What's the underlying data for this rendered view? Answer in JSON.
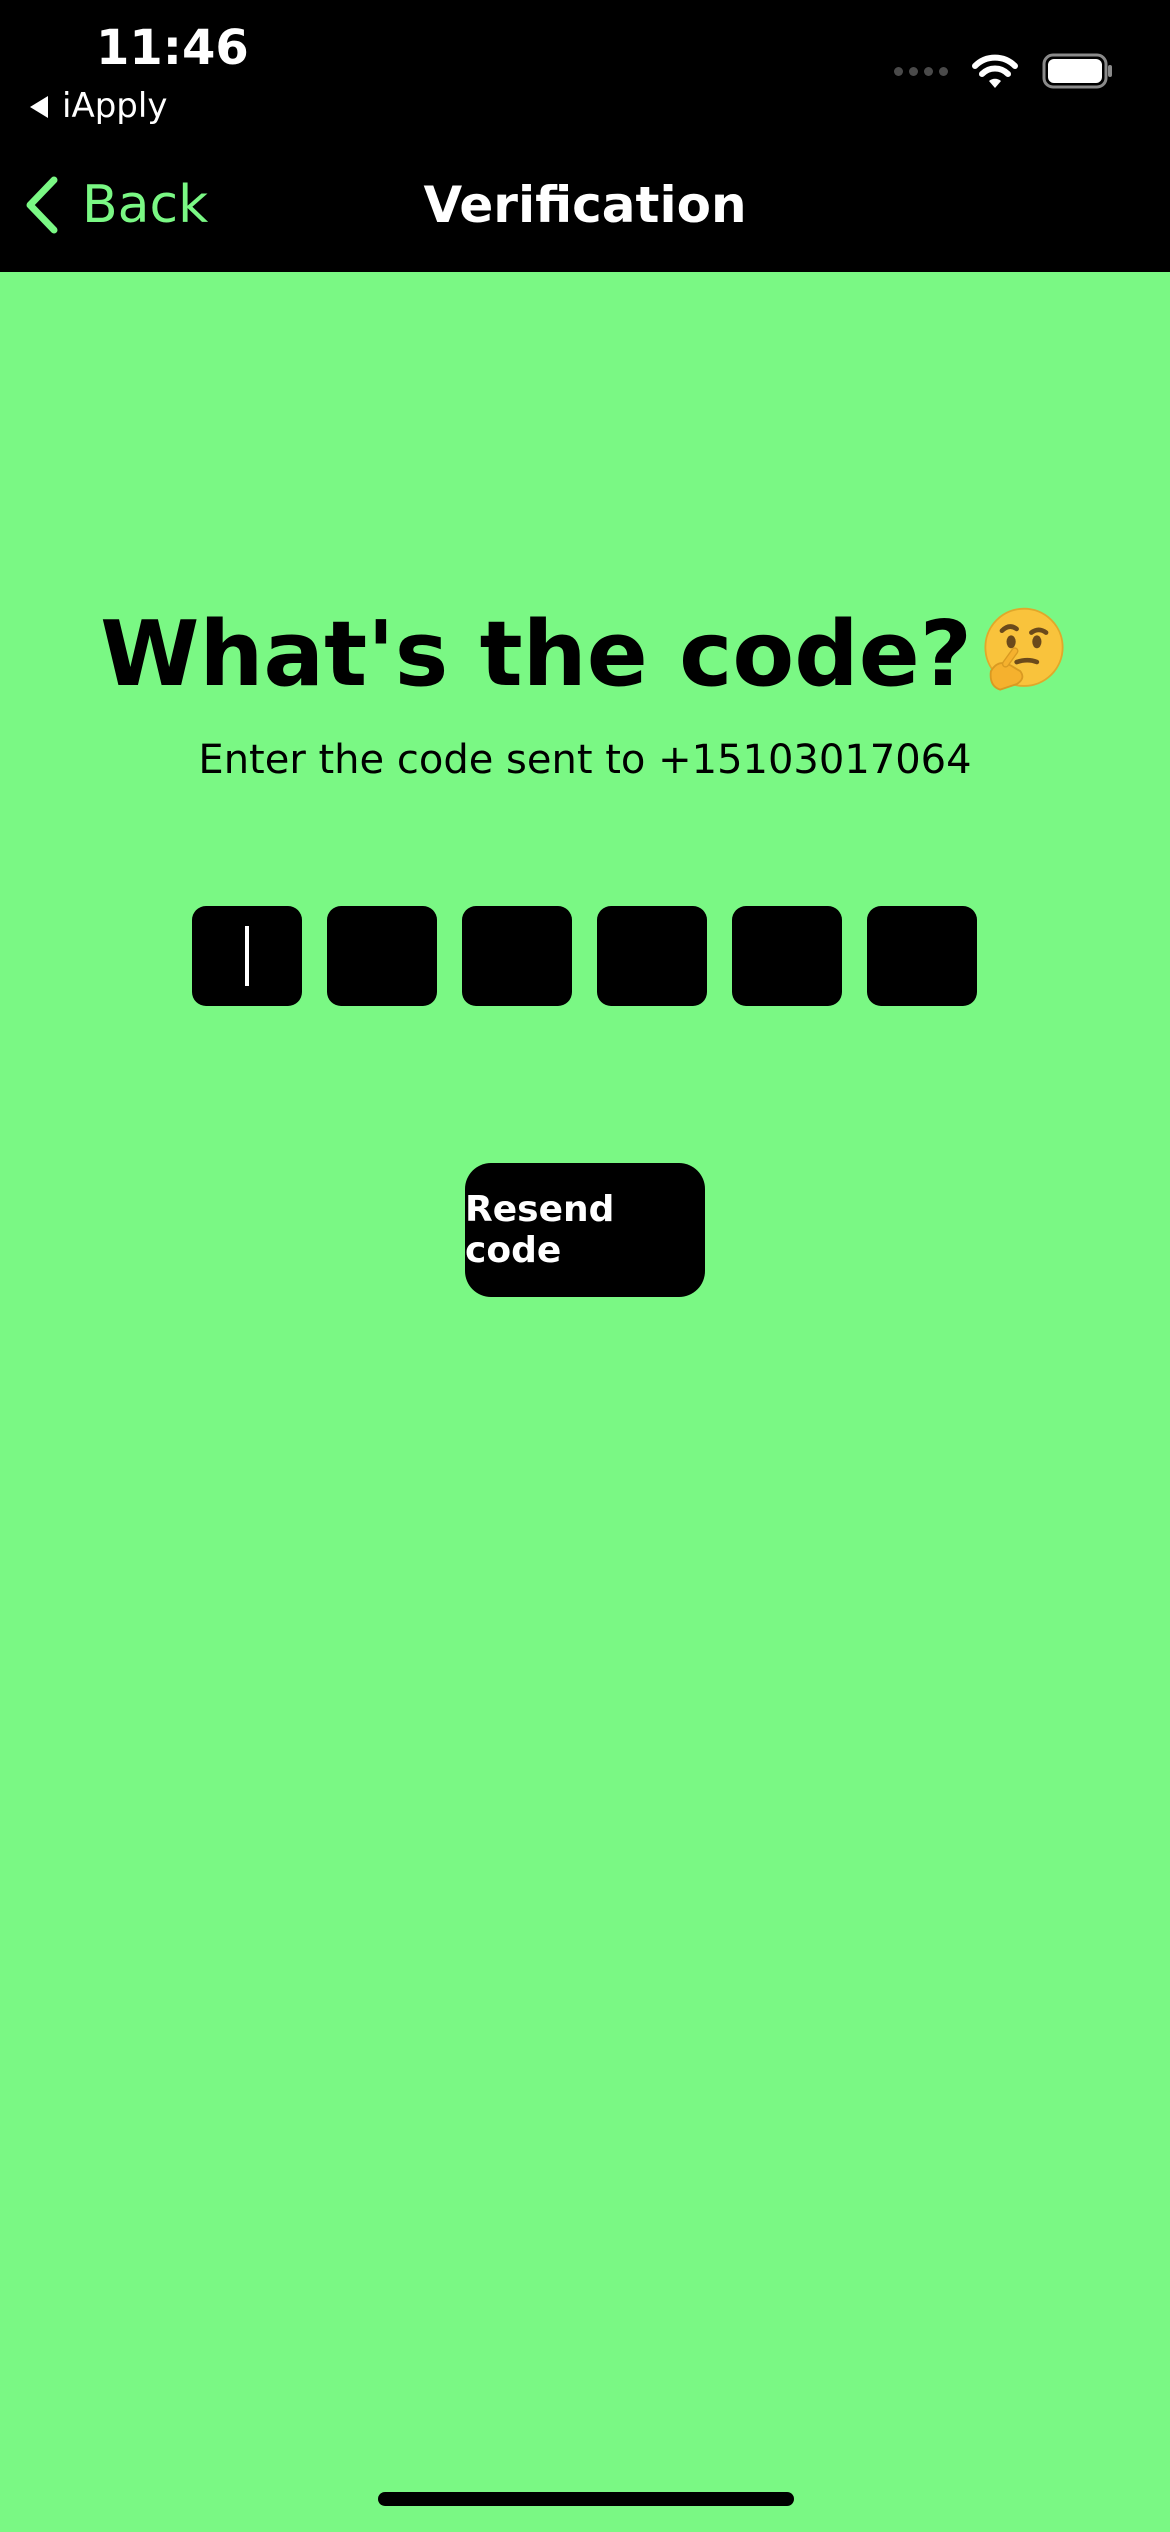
{
  "status_bar": {
    "time": "11:46",
    "back_app_label": "iApply",
    "signal_icon": "cellular-signal-icon",
    "wifi_icon": "wifi-icon",
    "battery_icon": "battery-icon"
  },
  "nav": {
    "back_label": "Back",
    "back_icon": "chevron-left-icon",
    "title": "Verification"
  },
  "main": {
    "heading": "What's the code?",
    "heading_emoji": "thinking-face-emoji",
    "subheading": "Enter the code sent to +15103017064",
    "code_digits": [
      "",
      "",
      "",
      "",
      "",
      ""
    ],
    "active_digit_index": 0,
    "resend_label": "Resend code"
  },
  "colors": {
    "background": "#7AF884",
    "accent": "#7AF884",
    "bar": "#000000",
    "text": "#000000"
  }
}
